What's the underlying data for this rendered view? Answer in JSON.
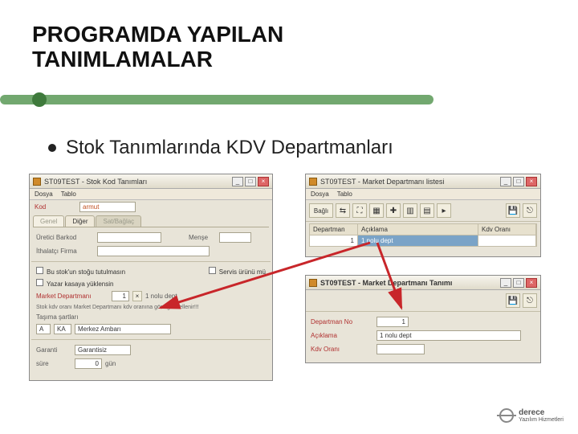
{
  "title_line1": "PROGRAMDA YAPILAN",
  "title_line2": "TANIMLAMALAR",
  "bullet": "Stok Tanımlarında KDV Departmanları",
  "win_left": {
    "title": "ST09TEST - Stok Kod Tanımları",
    "menu": [
      "Dosya",
      "Tablo"
    ],
    "lab_kod": "Kod",
    "kod_value": "armut",
    "tabs": [
      "Genel",
      "Diğer",
      "Sat/Bağlaç"
    ],
    "lab_uretici": "Üretici Barkod",
    "lab_ithalatci": "İthalatçı Firma",
    "lab_mense": "Menşe",
    "chk1_label": "Bu stok'un stoğu tutulmasın",
    "chk2_label": "Servis ürünü mü",
    "chk3_label": "Yazar kasaya yüklensin",
    "lab_market_dep": "Market Departmanı",
    "dep_no": "1",
    "dep_text": "1 nolu dept",
    "note_text": "Stok kdv oranı  Market Departmanı kdv oranına göre güncellenir!!!",
    "lab_tasyoma": "Taşıma şartları",
    "lower_row1_a": "A",
    "lower_row1_b": "KA",
    "lower_row1_c": "Merkez Ambarı",
    "lab_garanti": "Garanti",
    "garanti_value": "Garantisiz",
    "lab_sure": "süre",
    "sure_value": "0",
    "sure_unit": "gün"
  },
  "win_list": {
    "title": "ST09TEST - Market Departmanı listesi",
    "menu": [
      "Dosya",
      "Tablo"
    ],
    "btn_bigtext": "Bağlı",
    "cols": [
      "Departman",
      "Açıklama",
      "Kdv Oranı"
    ],
    "row_dep": "1",
    "row_desc": "1 nolu dept"
  },
  "win_def": {
    "title": "ST09TEST - Market Departmanı Tanımı",
    "lab_depno": "Departman No",
    "depno_value": "1",
    "lab_aciklama": "Açıklama",
    "aciklama_value": "1 nolu dept",
    "lab_kdv": "Kdv Oranı"
  },
  "logo": {
    "name": "derece",
    "sub": "Yazılım Hizmetleri"
  }
}
